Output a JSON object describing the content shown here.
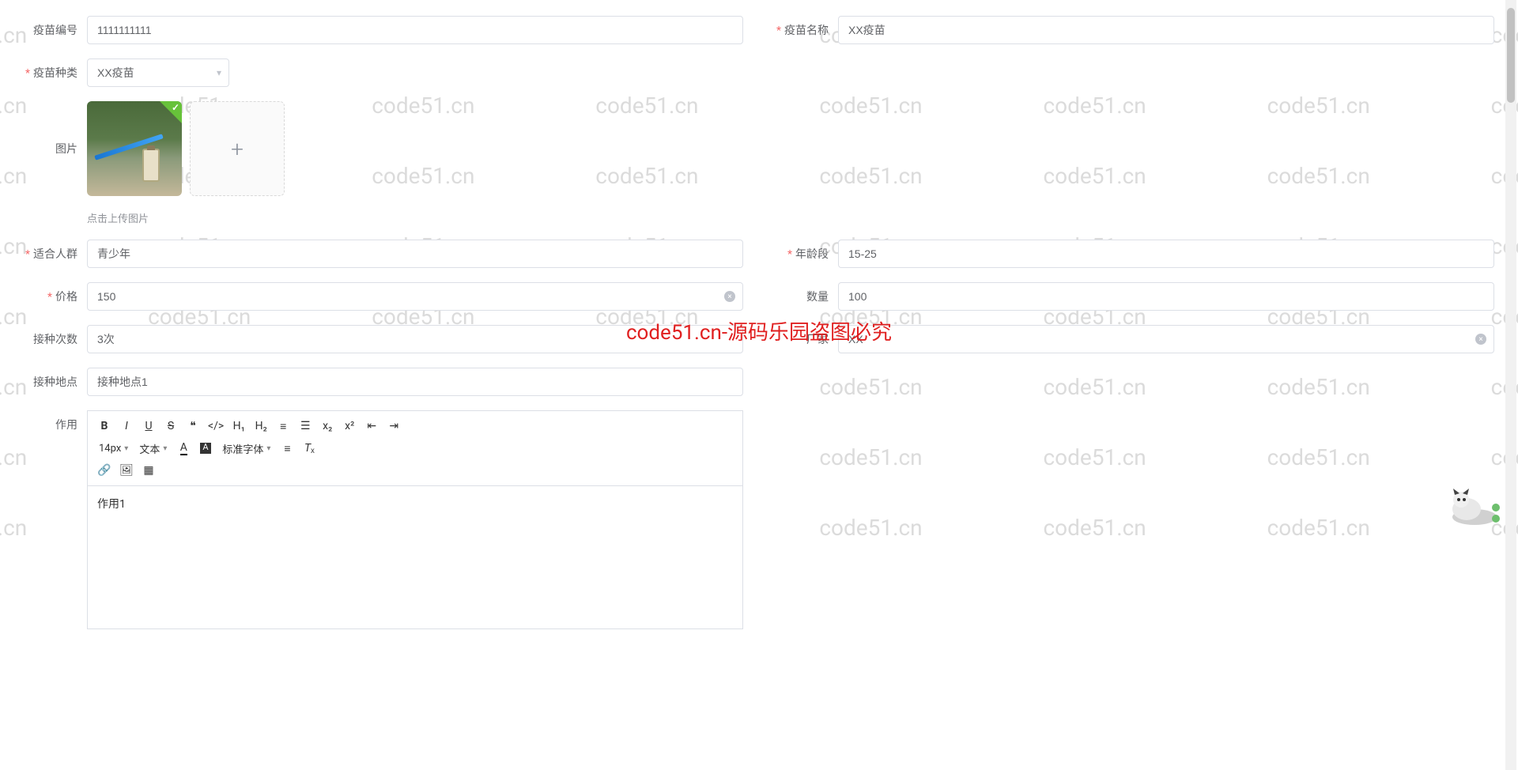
{
  "watermark": "code51.cn",
  "center_watermark": "code51.cn-源码乐园盗图必究",
  "form": {
    "vaccine_id": {
      "label": "疫苗编号",
      "value": "1111111111"
    },
    "vaccine_name": {
      "label": "疫苗名称",
      "value": "XX疫苗"
    },
    "vaccine_type": {
      "label": "疫苗种类",
      "value": "XX疫苗"
    },
    "image": {
      "label": "图片",
      "hint": "点击上传图片"
    },
    "suitable_people": {
      "label": "适合人群",
      "value": "青少年"
    },
    "age_range": {
      "label": "年龄段",
      "value": "15-25"
    },
    "price": {
      "label": "价格",
      "value": "150"
    },
    "quantity": {
      "label": "数量",
      "value": "100"
    },
    "doses": {
      "label": "接种次数",
      "value": "3次"
    },
    "manufacturer": {
      "label": "厂家",
      "value": "XX"
    },
    "location": {
      "label": "接种地点",
      "value": "接种地点1"
    },
    "effect": {
      "label": "作用",
      "content": "作用1"
    }
  },
  "editor_toolbar": {
    "font_size": "14px",
    "paragraph": "文本",
    "font_family": "标准字体"
  }
}
